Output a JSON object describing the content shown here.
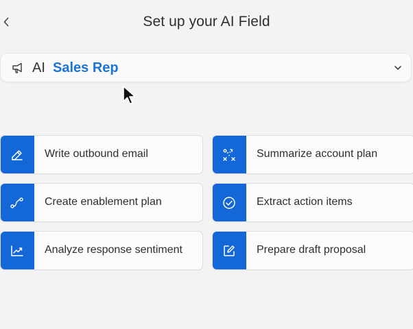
{
  "header": {
    "back_icon": "chevron-left-icon",
    "title": "Set up your AI Field"
  },
  "field_select": {
    "icon": "bullhorn-icon",
    "prefix": "AI",
    "value": "Sales Rep",
    "accent_color": "#1b74d6",
    "dropdown_icon": "chevron-down-icon"
  },
  "actions": [
    {
      "label": "Write outbound email",
      "icon": "pencil-icon"
    },
    {
      "label": "Summarize account plan",
      "icon": "strategy-icon"
    },
    {
      "label": "Create enablement plan",
      "icon": "path-icon"
    },
    {
      "label": "Extract action items",
      "icon": "check-circle-icon"
    },
    {
      "label": "Analyze response sentiment",
      "icon": "trend-chart-icon"
    },
    {
      "label": "Prepare draft proposal",
      "icon": "edit-box-icon"
    }
  ],
  "colors": {
    "icon_tile": "#1467d6",
    "background": "#f3f3f4"
  }
}
